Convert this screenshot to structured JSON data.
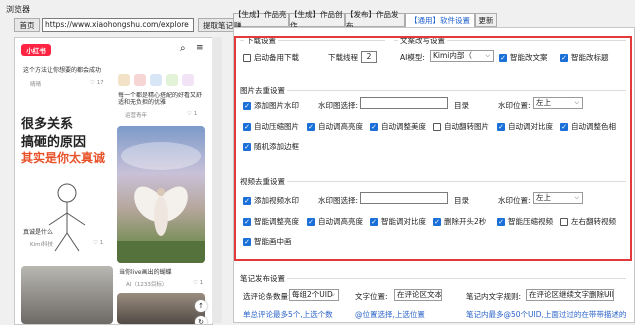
{
  "browser": {
    "label": "浏览器",
    "home_button": "首页",
    "url": "https://www.xiaohongshu.com/explore",
    "fetch_button": "提取笔记"
  },
  "webview": {
    "logo": "小红书",
    "top_left_text": "这个方法让你想要的都会成功",
    "top_left_author": "晴晴",
    "top_left_likes": "17",
    "top_right_text": "每一个都是精心搭配的好看又舒适和无负担的优雅",
    "top_right_author": "运营青年",
    "top_right_likes": "1",
    "promo_line1": "很多关系",
    "promo_line2": "搞砸的原因",
    "promo_line3": "其实是你太真诚",
    "card3_title": "真诚是什么",
    "card3_author": "Kimi科技",
    "card3_likes": "1",
    "card4_title": "当你live画出的蝴蝶",
    "card4_author": "AI（1233目标）",
    "card4_likes": "1"
  },
  "tabs": [
    {
      "label": "【生成】作品亮赚",
      "active": false
    },
    {
      "label": "【生成】作品创作",
      "active": false
    },
    {
      "label": "【发布】作品发布",
      "active": false
    },
    {
      "label": "【通用】软件设置",
      "active": true
    },
    {
      "label": "更新",
      "active": false
    }
  ],
  "download": {
    "title": "下载设置",
    "backup_download": {
      "label": "启动备用下载",
      "checked": false
    },
    "threads_label": "下载线程",
    "threads_value": "2"
  },
  "copy": {
    "title": "文案改写设置",
    "ai_model_label": "AI模型:",
    "ai_model_value": "Kimi内部（",
    "smart_rewrite": {
      "label": "智能改文案",
      "checked": true
    },
    "smart_title": {
      "label": "智能改标题",
      "checked": true
    }
  },
  "image": {
    "title": "图片去重设置",
    "add_watermark": {
      "label": "添加图片水印",
      "checked": true
    },
    "watermark_label": "水印图选择:",
    "watermark_value": "",
    "dir_button": "目录",
    "position_label": "水印位置:",
    "position_value": "左上",
    "options": [
      {
        "label": "自动压缩图片",
        "checked": true
      },
      {
        "label": "自动调高亮度",
        "checked": true
      },
      {
        "label": "自动调整美度",
        "checked": true
      },
      {
        "label": "自动翻转图片",
        "checked": false
      },
      {
        "label": "自动调对比度",
        "checked": true
      },
      {
        "label": "自动调整色相",
        "checked": true
      }
    ],
    "random_border": {
      "label": "随机添加边框",
      "checked": true
    }
  },
  "video": {
    "title": "视频去重设置",
    "add_watermark": {
      "label": "添加视频水印",
      "checked": true
    },
    "watermark_label": "水印图选择:",
    "watermark_value": "",
    "dir_button": "目录",
    "position_label": "水印位置:",
    "position_value": "左上",
    "options": [
      {
        "label": "智能调整亮度",
        "checked": true
      },
      {
        "label": "自动调高亮度",
        "checked": true
      },
      {
        "label": "智能调对比度",
        "checked": true
      },
      {
        "label": "删除开头2秒",
        "checked": true
      },
      {
        "label": "智能压缩视频",
        "checked": true
      },
      {
        "label": "左右翻转视频",
        "checked": false
      }
    ],
    "pip": {
      "label": "智能画中画",
      "checked": true
    }
  },
  "publish": {
    "title": "笔记发布设置",
    "select_count_label": "选评论条数量:",
    "select_count_value": "每组2个UID",
    "text_position_label": "文字位置:",
    "text_position_value": "在评论区文本",
    "rule_label": "笔记内文字规则:",
    "rule_value": "在评论区继续文字删除UID",
    "hint1": "单总评论最多5个,上选个数",
    "hint2": "@位置选择,上选位置",
    "hint3": "笔记内最多@50个UID,上面过过的在带带描述的"
  },
  "colors": {
    "accent": "#1a6fd8",
    "highlight_border": "#e23a3a",
    "brand": "#ff2442"
  }
}
